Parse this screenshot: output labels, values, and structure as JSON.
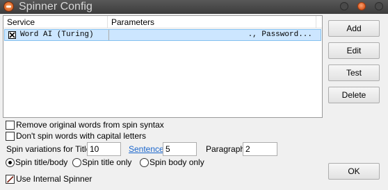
{
  "window": {
    "title": "Spinner Config"
  },
  "list": {
    "columns": [
      "Service",
      "Parameters"
    ],
    "rows": [
      {
        "checked": true,
        "service": "Word AI (Turing)",
        "parameters": "., Password..."
      }
    ]
  },
  "buttons": {
    "add": "Add",
    "edit": "Edit",
    "test": "Test",
    "delete": "Delete",
    "ok": "OK"
  },
  "options": {
    "remove_original": {
      "label": "Remove original words from spin syntax",
      "checked": false
    },
    "dont_spin_capitals": {
      "label": "Don't spin words with capital letters",
      "checked": false
    },
    "use_internal": {
      "label": "Use Internal Spinner",
      "checked": true
    }
  },
  "variations": {
    "title_label": "Spin variations for Title",
    "title_value": "10",
    "sentence_label": "Sentence",
    "sentence_value": "5",
    "paragraph_label": "Paragraph",
    "paragraph_value": "2"
  },
  "spin_mode": {
    "options": [
      "Spin title/body",
      "Spin title only",
      "Spin body only"
    ],
    "selected": "Spin title/body"
  }
}
